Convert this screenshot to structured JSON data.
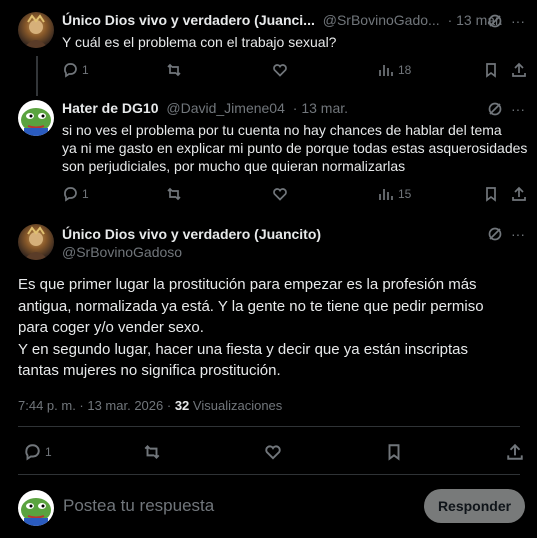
{
  "tweet1": {
    "name": "Único Dios vivo y verdadero (Juanci...",
    "handle": "@SrBovinoGado...",
    "time": "· 13 mar.",
    "text": "Y cuál es el problema con el trabajo sexual?",
    "replies": "1",
    "retweets": "",
    "views": "18"
  },
  "tweet2": {
    "name": "Hater de DG10",
    "handle": "@David_Jimene04",
    "time": "· 13 mar.",
    "text": "si no ves el problema por tu cuenta no hay chances de hablar del tema\nya ni me gasto en explicar mi punto de porque todas estas asquerosidades\nson perjudiciales, por mucho que quieran normalizarlas",
    "replies": "1",
    "views": "15"
  },
  "main": {
    "name": "Único Dios vivo y verdadero (Juancito)",
    "handle": "@SrBovinoGadoso",
    "text": "Es que primer lugar la prostitución para empezar es la profesión más\nantigua, normalizada ya está. Y la gente no te tiene que pedir permiso\npara coger y/o vender sexo.\nY en segundo lugar, hacer una fiesta y decir que ya están inscriptas\ntantas mujeres no significa prostitución.",
    "time": "7:44 p. m. · 13 mar. 2026 ·",
    "views_count": "32",
    "views_label": "Visualizaciones",
    "replies": "1"
  },
  "reply_box": {
    "placeholder": "Postea tu respuesta",
    "button": "Responder"
  }
}
